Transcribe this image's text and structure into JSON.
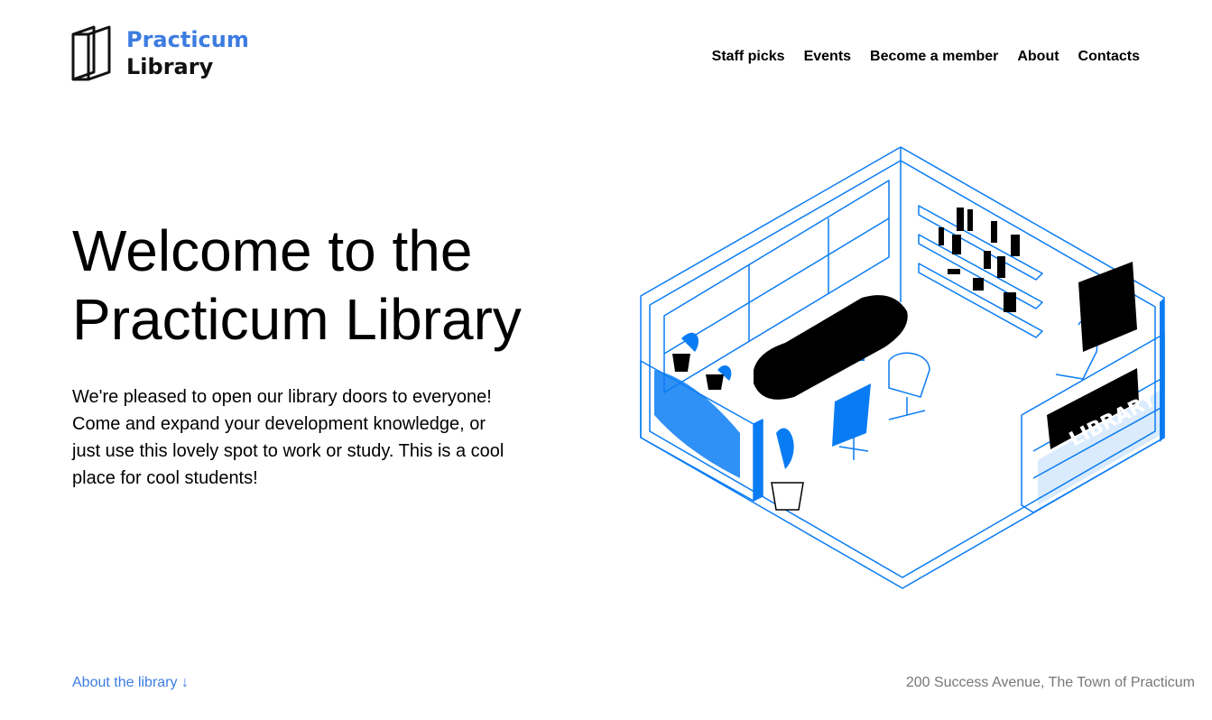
{
  "colors": {
    "accent": "#0a7cf3",
    "link": "#3d7ce0",
    "muted": "#777777",
    "text": "#000000"
  },
  "logo": {
    "line1": "Practicum",
    "line2": "Library",
    "icon": "book-icon"
  },
  "nav": {
    "items": [
      {
        "label": "Staff picks"
      },
      {
        "label": "Events"
      },
      {
        "label": "Become a member"
      },
      {
        "label": "About"
      },
      {
        "label": "Contacts"
      }
    ]
  },
  "hero": {
    "title": "Welcome to the Practicum Library",
    "text": "We're pleased to open our library doors to everyone! Come and expand your development knowledge, or just use this lovely spot to work or study. This is a cool place for cool students!"
  },
  "illustration": {
    "sign": "LIBRARY"
  },
  "footer": {
    "link": "About the library ↓",
    "address": "200 Success Avenue, The Town of Practicum"
  }
}
